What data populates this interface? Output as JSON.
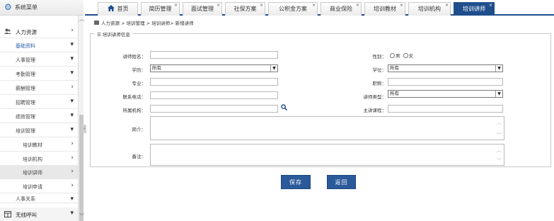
{
  "sidebar": {
    "header_title": "系统菜单",
    "top_menu": "人力资源",
    "items": [
      {
        "label": "基础资料"
      },
      {
        "label": "人事管理"
      },
      {
        "label": "考勤管理"
      },
      {
        "label": "薪酬管理"
      },
      {
        "label": "招聘管理"
      },
      {
        "label": "绩效管理"
      },
      {
        "label": "培训管理"
      }
    ],
    "sub_items": [
      {
        "label": "培训教材"
      },
      {
        "label": "培训机构"
      },
      {
        "label": "培训讲师"
      },
      {
        "label": "培训申请"
      }
    ],
    "bottom_partial": "人事关系",
    "bottom_menu": "无线呼叫"
  },
  "tabs": [
    {
      "label": "首页"
    },
    {
      "label": "简历管理"
    },
    {
      "label": "面试管理"
    },
    {
      "label": "社保方案"
    },
    {
      "label": "公积金方案"
    },
    {
      "label": "商业保险"
    },
    {
      "label": "培训教材"
    },
    {
      "label": "培训机构"
    },
    {
      "label": "培训讲师"
    }
  ],
  "breadcrumb": "人力资源 > 培训管理 > 培训讲师> 新增讲师",
  "form": {
    "legend": "培训讲师信息",
    "name_label": "讲师姓名：",
    "name_value": "",
    "gender_label": "性别：",
    "gender_male": "男",
    "gender_female": "女",
    "education_label": "学历：",
    "education_value": "所有",
    "degree_label": "学位：",
    "degree_value": "所有",
    "major_label": "专业：",
    "major_value": "",
    "title_label": "职称：",
    "title_value": "",
    "phone_label": "联系电话：",
    "phone_value": "",
    "type_label": "讲师类型：",
    "type_value": "所有",
    "org_label": "所属机构：",
    "org_value": "",
    "course_label": "主讲课程：",
    "course_value": "",
    "intro_label": "简介：",
    "remark_label": "备注："
  },
  "buttons": {
    "save": "保存",
    "back": "返回"
  },
  "colors": {
    "accent": "#1f4e8c",
    "button": "#2a5a9a"
  }
}
